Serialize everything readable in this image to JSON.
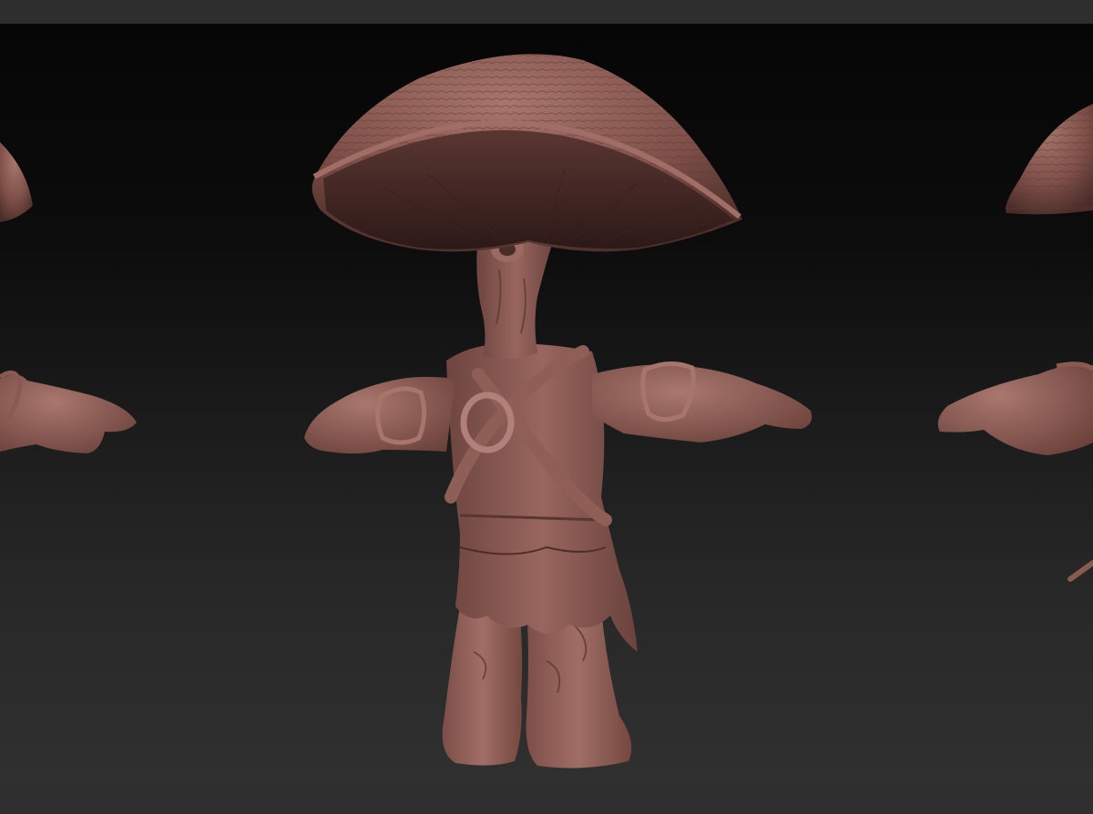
{
  "viewport": {
    "background": [
      "#060606",
      "#303030"
    ],
    "material_color": "#8a5a52",
    "views": [
      "left",
      "front",
      "right"
    ]
  },
  "model": {
    "icon": "mushroom-creature-sculpt"
  }
}
